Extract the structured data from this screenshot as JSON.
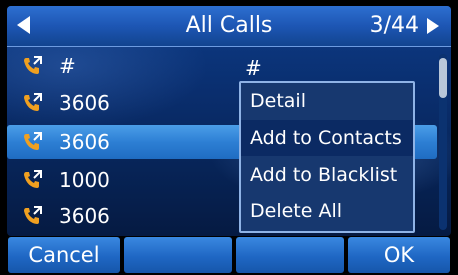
{
  "header": {
    "title": "All Calls",
    "page": "3/44",
    "left_icon": "triangle-left-icon",
    "right_icon": "triangle-right-icon"
  },
  "calls": [
    {
      "number": "#",
      "icon": "incoming-call-icon"
    },
    {
      "number": "3606",
      "icon": "incoming-call-icon"
    },
    {
      "number": "3606",
      "icon": "incoming-call-icon",
      "selected": true
    },
    {
      "number": "1000",
      "icon": "incoming-call-icon"
    },
    {
      "number": "3606",
      "icon": "incoming-call-icon"
    }
  ],
  "background_text": "#",
  "context_menu": {
    "items": [
      {
        "label": "Detail"
      },
      {
        "label": "Add to Contacts",
        "selected": true
      },
      {
        "label": "Add to Blacklist"
      },
      {
        "label": "Delete All"
      }
    ]
  },
  "softkeys": {
    "left": "Cancel",
    "mid1": "",
    "mid2": "",
    "right": "OK"
  },
  "colors": {
    "accent": "#1d56b4",
    "selected_row": "#2d7fd4",
    "phone_icon": "#f0a020"
  }
}
